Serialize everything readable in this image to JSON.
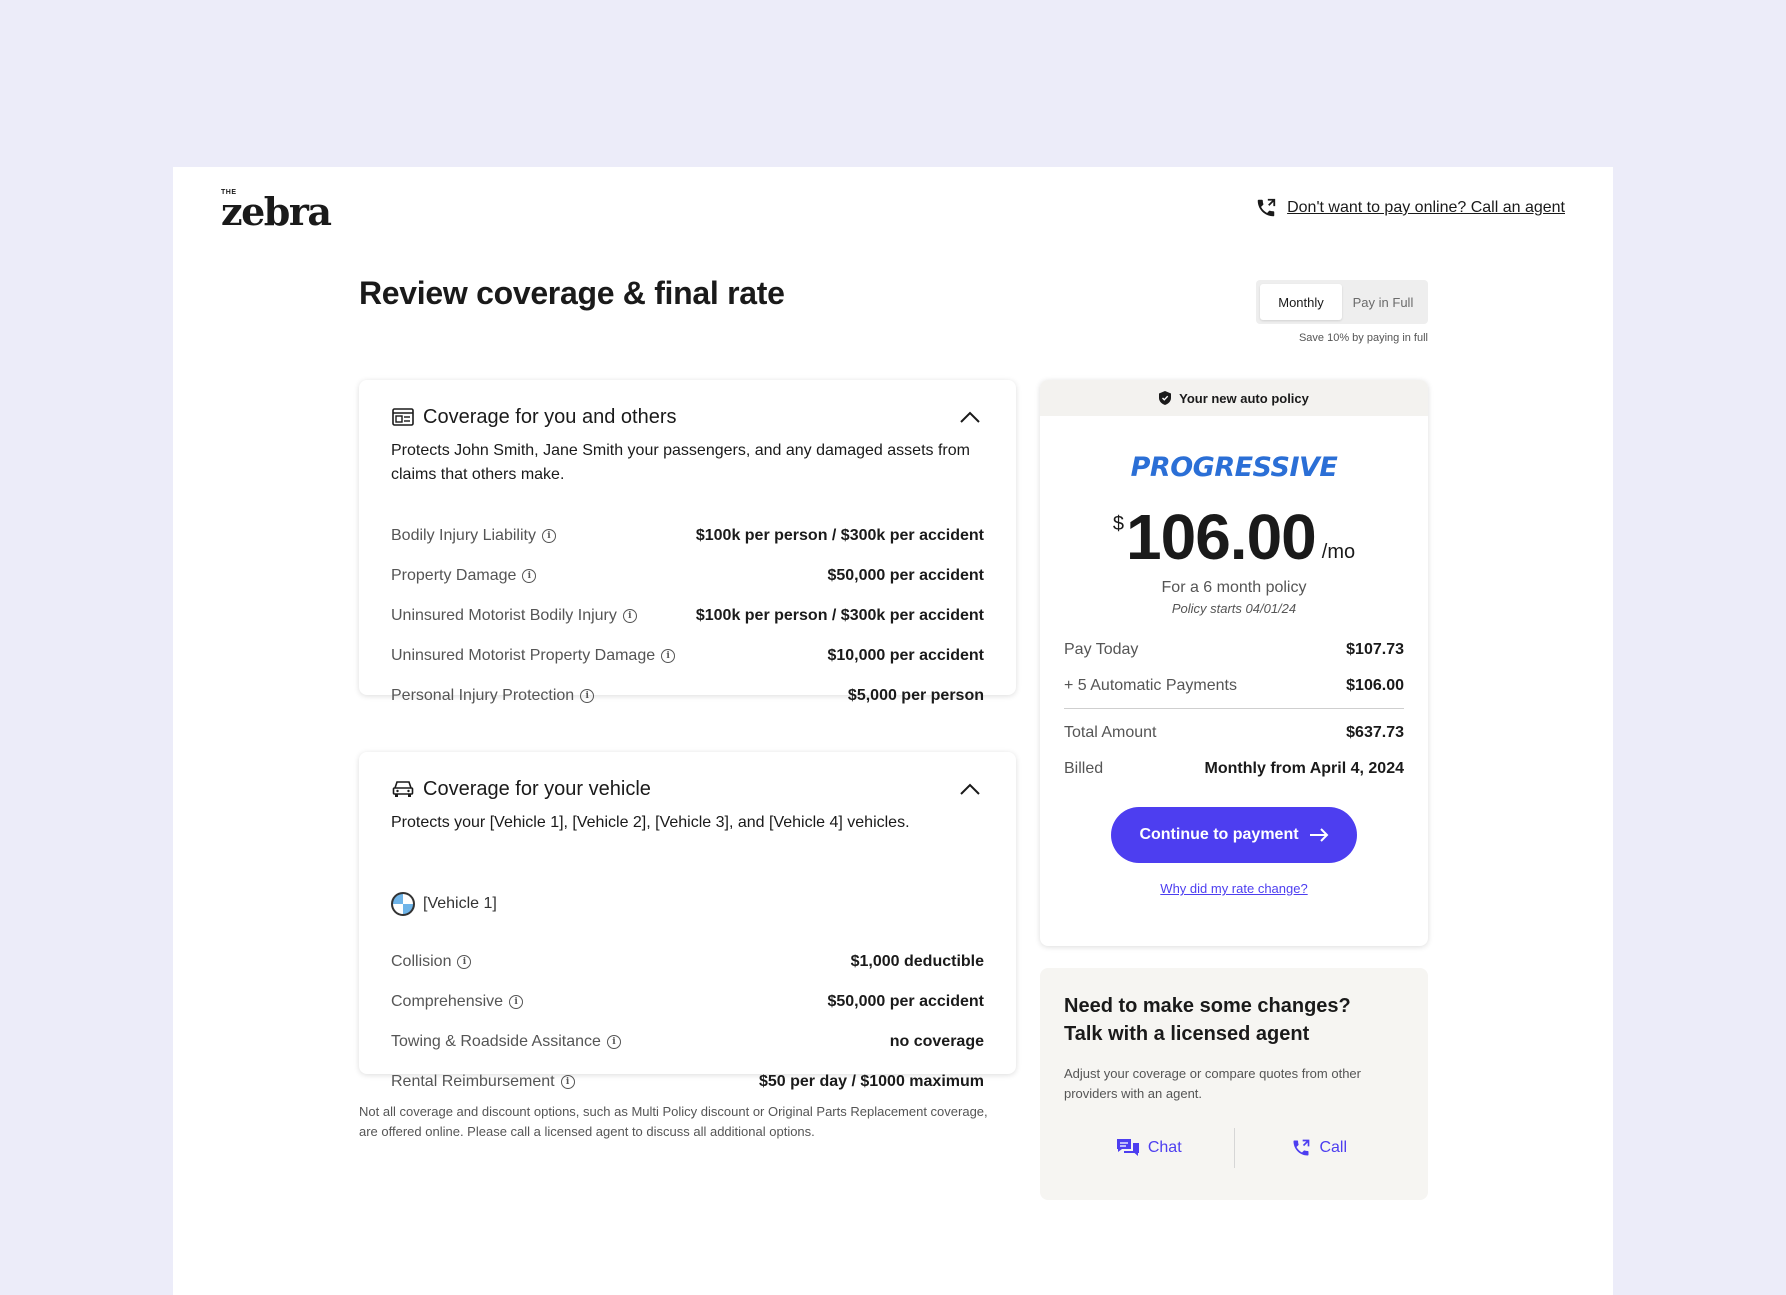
{
  "colors": {
    "accent": "#4d3ef0",
    "background": "#ececf9",
    "brand_blue": "#2b6fd6"
  },
  "header": {
    "logo_small": "THE",
    "logo_word": "zebra",
    "call_link": "Don't want to pay online? Call an agent"
  },
  "page_title": "Review coverage & final rate",
  "payment_toggle": {
    "options": [
      "Monthly",
      "Pay in Full"
    ],
    "selected": "Monthly",
    "note": "Save 10% by paying in full"
  },
  "coverage_others": {
    "title": "Coverage for you and others",
    "description": "Protects John Smith, Jane Smith your passengers, and any damaged assets from claims that others make.",
    "rows": [
      {
        "label": "Bodily Injury Liability",
        "value": "$100k per person / $300k per accident"
      },
      {
        "label": "Property Damage",
        "value": "$50,000 per accident"
      },
      {
        "label": "Uninsured Motorist Bodily Injury",
        "value": "$100k per person / $300k per accident"
      },
      {
        "label": "Uninsured Motorist Property Damage",
        "value": "$10,000 per accident"
      },
      {
        "label": "Personal Injury Protection",
        "value": "$5,000 per person"
      }
    ]
  },
  "coverage_vehicle": {
    "title": "Coverage for your vehicle",
    "description": "Protects your [Vehicle 1], [Vehicle 2], [Vehicle 3], and [Vehicle 4] vehicles.",
    "vehicle_name": "[Vehicle 1]",
    "rows": [
      {
        "label": "Collision",
        "value": "$1,000 deductible"
      },
      {
        "label": "Comprehensive",
        "value": "$50,000 per accident"
      },
      {
        "label": "Towing & Roadside Assitance",
        "value": "no coverage"
      },
      {
        "label": "Rental Reimbursement",
        "value": "$50 per day / $1000 maximum"
      }
    ]
  },
  "disclaimer": "Not all coverage and discount options, such as Multi Policy discount or Original Parts Replacement coverage, are offered online. Please call a licensed agent to discuss all additional options.",
  "policy": {
    "header": "Your new auto policy",
    "insurer": "PROGRESSIVE",
    "currency": "$",
    "amount": "106.00",
    "per": "/mo",
    "term": "For a 6 month policy",
    "starts": "Policy starts 04/01/24",
    "lines_top": [
      {
        "label": "Pay Today",
        "value": "$107.73"
      },
      {
        "label": "+ 5 Automatic Payments",
        "value": "$106.00"
      }
    ],
    "lines_bottom": [
      {
        "label": "Total Amount",
        "value": "$637.73"
      },
      {
        "label": "Billed",
        "value": "Monthly from April 4, 2024"
      }
    ],
    "cta": "Continue to payment",
    "rate_link": "Why did my rate change?"
  },
  "agent": {
    "heading_line1": "Need to make some changes?",
    "heading_line2": "Talk with a licensed agent",
    "description": "Adjust your coverage or compare quotes from other providers with an agent.",
    "chat_label": "Chat",
    "call_label": "Call"
  },
  "icons": [
    "phone-icon",
    "id-card-icon",
    "car-icon",
    "chevron-up-icon",
    "info-icon",
    "bmw-logo-icon",
    "shield-icon",
    "arrow-right-icon",
    "chat-icon"
  ]
}
